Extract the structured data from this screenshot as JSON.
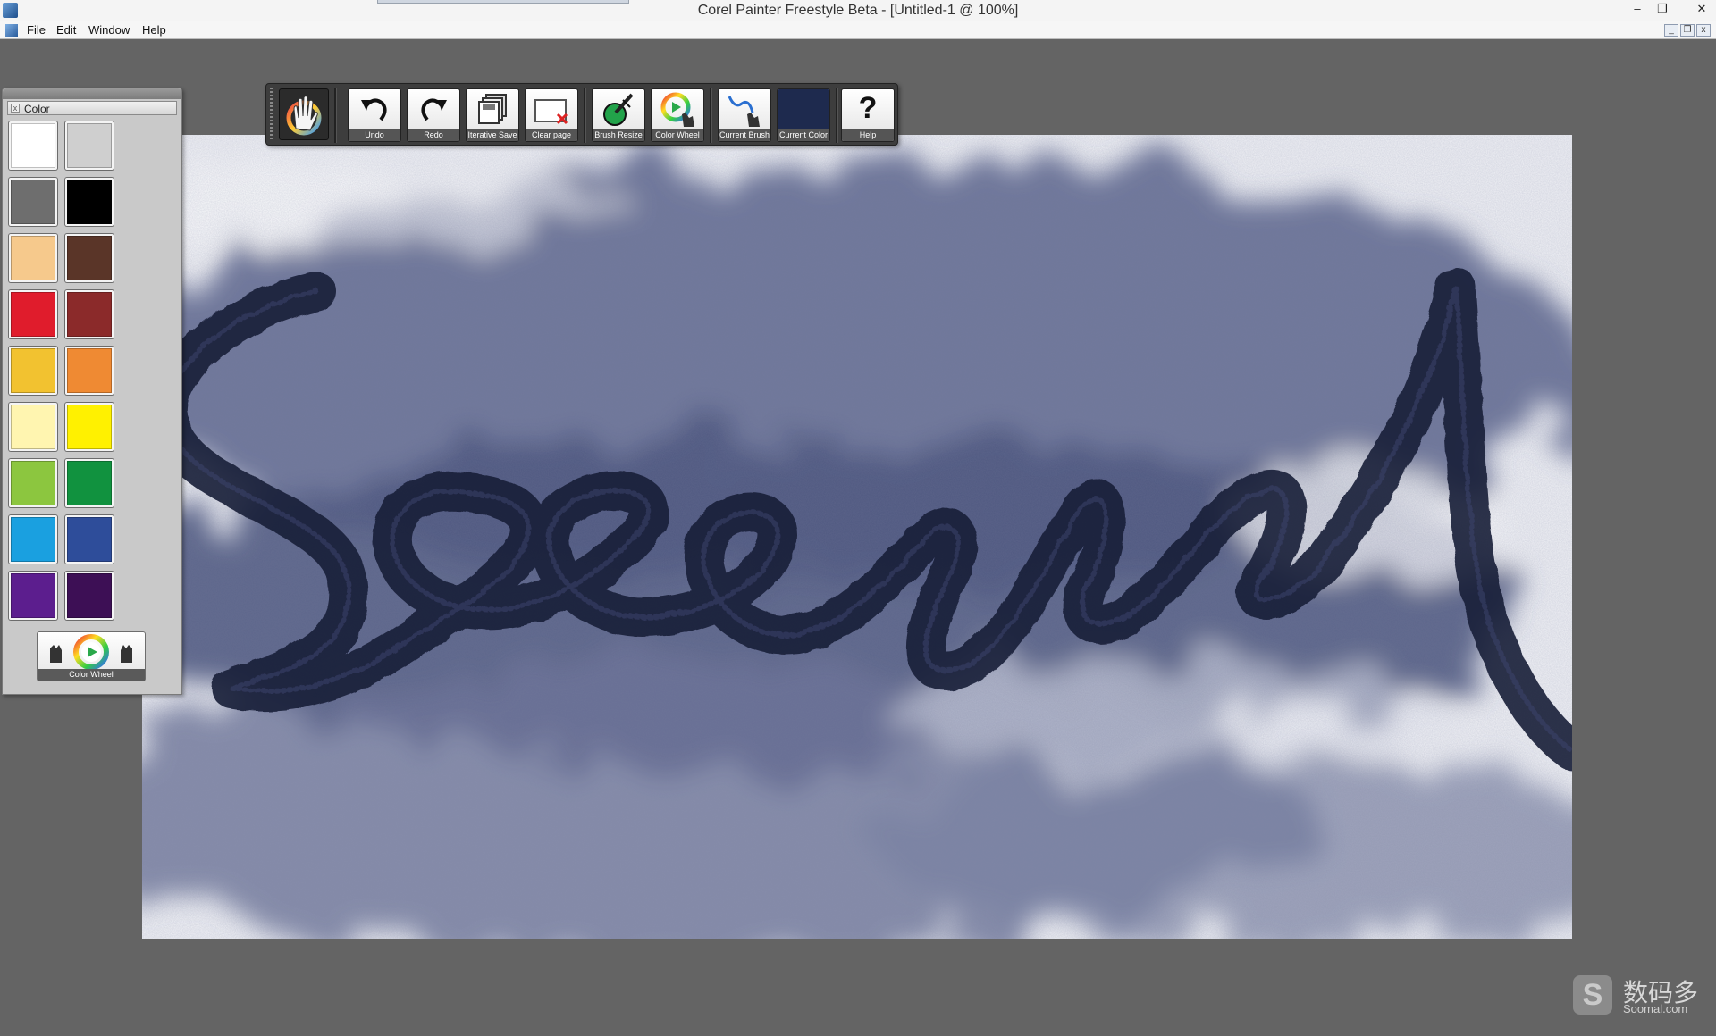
{
  "window": {
    "title": "Corel Painter Freestyle Beta - [Untitled-1 @ 100%]",
    "controls": {
      "minimize": "–",
      "restore": "❐",
      "close": "✕"
    }
  },
  "menu": {
    "items": [
      "File",
      "Edit",
      "Window",
      "Help"
    ],
    "mdi_controls": {
      "minimize": "_",
      "restore": "❐",
      "close": "x"
    }
  },
  "color_panel": {
    "title": "Color",
    "close_glyph": "x",
    "swatches": [
      "#ffffff",
      "#cfcfcf",
      "#6e6e6e",
      "#000000",
      "#f6c98c",
      "#5a3528",
      "#e01c2c",
      "#8b2a2a",
      "#f2c230",
      "#ef8a33",
      "#fff5b0",
      "#fff100",
      "#8cc63f",
      "#11923f",
      "#1aa0e0",
      "#2e4d9a",
      "#5c1e8e",
      "#3d0f55"
    ],
    "color_wheel_label": "Color Wheel"
  },
  "toolbar": {
    "tools": [
      {
        "label": "Undo"
      },
      {
        "label": "Redo"
      },
      {
        "label": "Iterative Save"
      },
      {
        "label": "Clear page"
      },
      {
        "label": "Brush Resize"
      },
      {
        "label": "Color Wheel"
      },
      {
        "label": "Current Brush"
      },
      {
        "label": "Current Color",
        "color": "#1e2a4e"
      },
      {
        "label": "Help",
        "glyph": "?"
      }
    ]
  },
  "watermark": {
    "logo": "S",
    "name_cn": "数码多",
    "site": "Soomal.com"
  }
}
